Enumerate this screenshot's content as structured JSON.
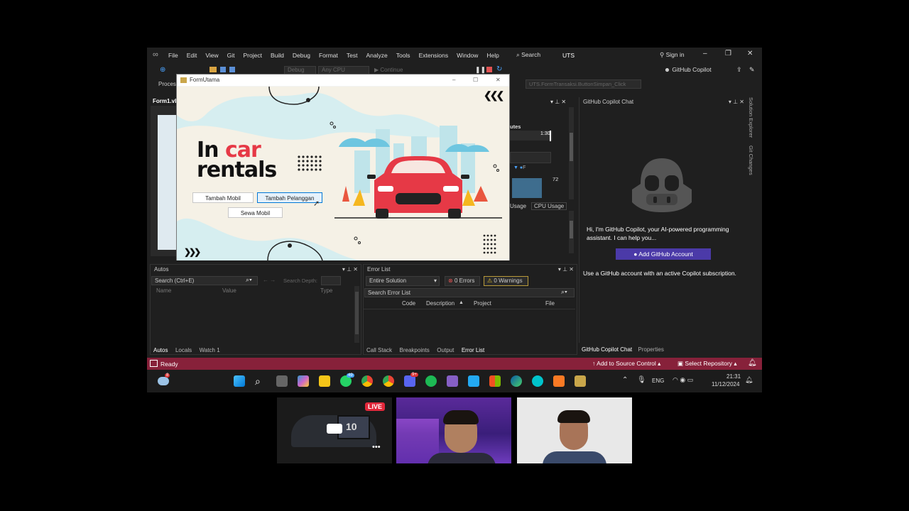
{
  "vs": {
    "menu": [
      "File",
      "Edit",
      "View",
      "Git",
      "Project",
      "Build",
      "Debug",
      "Format",
      "Test",
      "Analyze",
      "Tools",
      "Extensions",
      "Window",
      "Help"
    ],
    "search_label": "Search",
    "solution_name": "UTS",
    "sign_in": "Sign in",
    "copilot_button": "GitHub Copilot",
    "toolbar_debug": "Debug",
    "toolbar_cpu": "Any CPU",
    "toolbar_continue": "Continue",
    "process_label": "Proces",
    "frame_name": "UTS.FormTransaksi.ButtonSimpan_Click",
    "doc_tab": "Form1.vb",
    "diag": {
      "title_partial": "utes",
      "time": "1:30",
      "value": "72",
      "tab1": "Usage",
      "tab2": "CPU Usage",
      "legend": "F"
    },
    "autos": {
      "title": "Autos",
      "search_placeholder": "Search (Ctrl+E)",
      "search_depth": "Search Depth:",
      "columns": [
        "Name",
        "Value",
        "Type"
      ],
      "tabs": [
        "Autos",
        "Locals",
        "Watch 1"
      ]
    },
    "error_list": {
      "title": "Error List",
      "scope": "Entire Solution",
      "errors": "0 Errors",
      "warnings": "0 Warnings",
      "search_placeholder": "Search Error List",
      "columns": [
        "Code",
        "Description",
        "Project",
        "File"
      ],
      "tabs": [
        "Call Stack",
        "Breakpoints",
        "Output",
        "Error List"
      ]
    },
    "copilot": {
      "title": "GitHub Copilot Chat",
      "message": "Hi, I'm GitHub Copilot, your AI-powered programming assistant. I can help you...",
      "button": "Add GitHub Account",
      "note": "Use a GitHub account with an active Copilot subscription.",
      "tabs": [
        "GitHub Copilot Chat",
        "Properties"
      ],
      "side_tabs": [
        "Solution Explorer",
        "Git Changes"
      ]
    },
    "status": {
      "ready": "Ready",
      "source_control": "Add to Source Control",
      "repository": "Select Repository"
    },
    "taskbar": {
      "lang": "ENG",
      "time": "21:31",
      "date": "11/12/2024",
      "whatsapp_badge": "49",
      "discord_badge": "9+",
      "weather_badge": "8"
    }
  },
  "form": {
    "title": "FormUtama",
    "headline_1": "In ",
    "headline_car": "car",
    "headline_2": "rentals",
    "btn_mobil": "Tambah Mobil",
    "btn_pelanggan": "Tambah Pelanggan",
    "btn_sewa": "Sewa Mobil",
    "arrows_right": "❮❮❮",
    "arrows_left": "❯❯❯"
  },
  "stream": {
    "live": "LIVE",
    "score": "10",
    "more": "•••"
  },
  "colors": {
    "accent_red": "#e63946",
    "status": "#87213a",
    "copilot_btn": "#4b3aa8"
  }
}
